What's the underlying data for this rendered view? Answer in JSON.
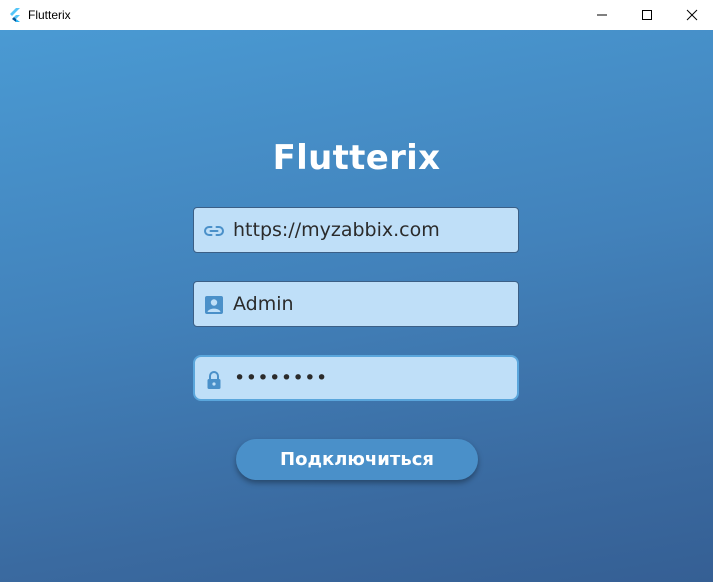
{
  "window": {
    "title": "Flutterix"
  },
  "brand": {
    "title": "Flutterix"
  },
  "form": {
    "url": {
      "value": "https://myzabbix.com",
      "icon": "link-icon"
    },
    "username": {
      "value": "Admin",
      "icon": "account-box-icon"
    },
    "password": {
      "value": "••••••••",
      "icon": "lock-icon"
    },
    "connect_label": "Подключиться"
  },
  "colors": {
    "background_top": "#4a9ad3",
    "background_bottom": "#355f94",
    "field_fill": "#bfdff8",
    "icon_color": "#4a90c9",
    "button_fill": "#4a90c9",
    "focus_border": "#5aa6dc"
  }
}
